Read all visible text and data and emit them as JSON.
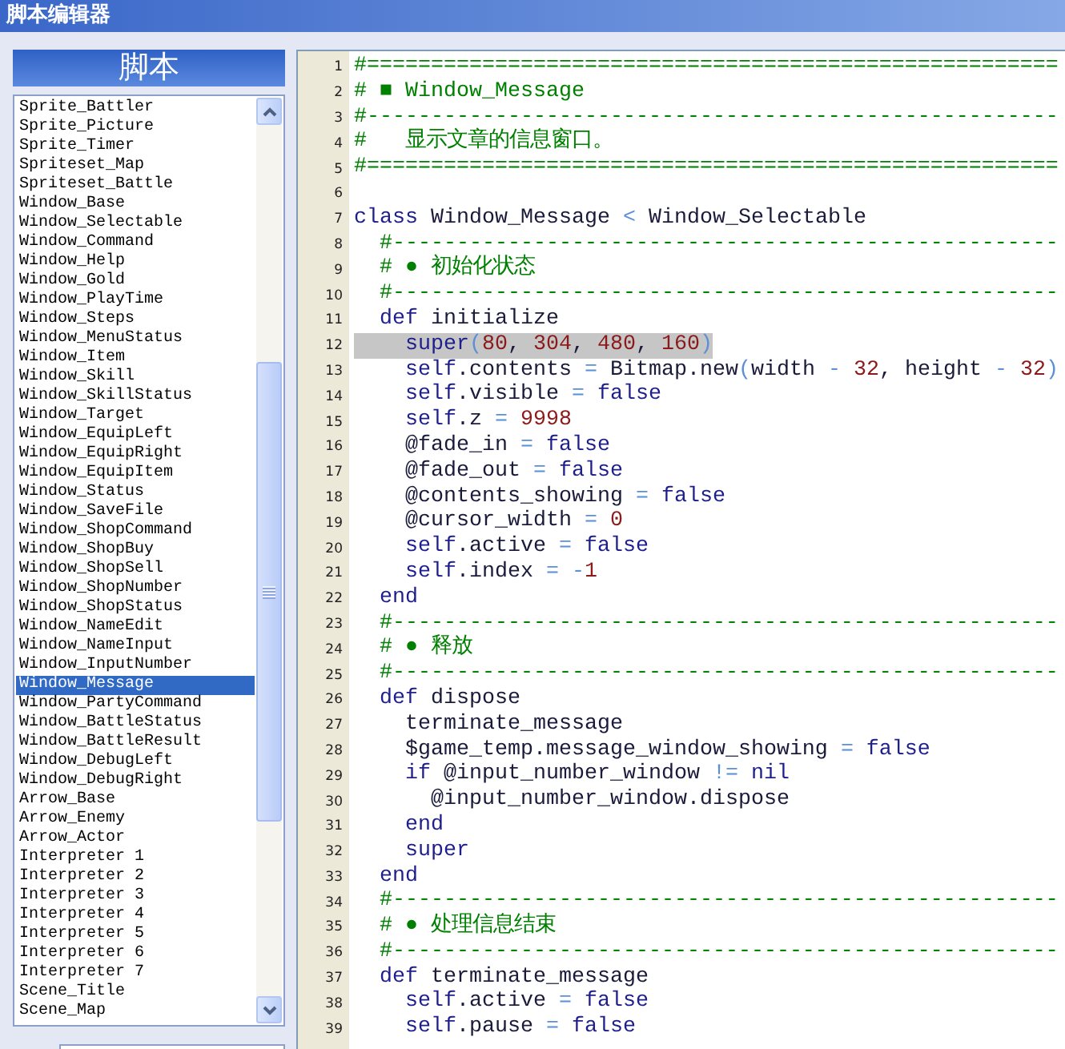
{
  "window": {
    "title": "脚本编辑器"
  },
  "sidebar": {
    "title": "脚本",
    "items": [
      {
        "label": "Sprite_Battler",
        "selected": false
      },
      {
        "label": "Sprite_Picture",
        "selected": false
      },
      {
        "label": "Sprite_Timer",
        "selected": false
      },
      {
        "label": "Spriteset_Map",
        "selected": false
      },
      {
        "label": "Spriteset_Battle",
        "selected": false
      },
      {
        "label": "Window_Base",
        "selected": false
      },
      {
        "label": "Window_Selectable",
        "selected": false
      },
      {
        "label": "Window_Command",
        "selected": false
      },
      {
        "label": "Window_Help",
        "selected": false
      },
      {
        "label": "Window_Gold",
        "selected": false
      },
      {
        "label": "Window_PlayTime",
        "selected": false
      },
      {
        "label": "Window_Steps",
        "selected": false
      },
      {
        "label": "Window_MenuStatus",
        "selected": false
      },
      {
        "label": "Window_Item",
        "selected": false
      },
      {
        "label": "Window_Skill",
        "selected": false
      },
      {
        "label": "Window_SkillStatus",
        "selected": false
      },
      {
        "label": "Window_Target",
        "selected": false
      },
      {
        "label": "Window_EquipLeft",
        "selected": false
      },
      {
        "label": "Window_EquipRight",
        "selected": false
      },
      {
        "label": "Window_EquipItem",
        "selected": false
      },
      {
        "label": "Window_Status",
        "selected": false
      },
      {
        "label": "Window_SaveFile",
        "selected": false
      },
      {
        "label": "Window_ShopCommand",
        "selected": false
      },
      {
        "label": "Window_ShopBuy",
        "selected": false
      },
      {
        "label": "Window_ShopSell",
        "selected": false
      },
      {
        "label": "Window_ShopNumber",
        "selected": false
      },
      {
        "label": "Window_ShopStatus",
        "selected": false
      },
      {
        "label": "Window_NameEdit",
        "selected": false
      },
      {
        "label": "Window_NameInput",
        "selected": false
      },
      {
        "label": "Window_InputNumber",
        "selected": false
      },
      {
        "label": "Window_Message",
        "selected": true
      },
      {
        "label": "Window_PartyCommand",
        "selected": false
      },
      {
        "label": "Window_BattleStatus",
        "selected": false
      },
      {
        "label": "Window_BattleResult",
        "selected": false
      },
      {
        "label": "Window_DebugLeft",
        "selected": false
      },
      {
        "label": "Window_DebugRight",
        "selected": false
      },
      {
        "label": "Arrow_Base",
        "selected": false
      },
      {
        "label": "Arrow_Enemy",
        "selected": false
      },
      {
        "label": "Arrow_Actor",
        "selected": false
      },
      {
        "label": "Interpreter 1",
        "selected": false
      },
      {
        "label": "Interpreter 2",
        "selected": false
      },
      {
        "label": "Interpreter 3",
        "selected": false
      },
      {
        "label": "Interpreter 4",
        "selected": false
      },
      {
        "label": "Interpreter 5",
        "selected": false
      },
      {
        "label": "Interpreter 6",
        "selected": false
      },
      {
        "label": "Interpreter 7",
        "selected": false
      },
      {
        "label": "Scene_Title",
        "selected": false
      },
      {
        "label": "Scene_Map",
        "selected": false
      }
    ]
  },
  "editor": {
    "lines": [
      {
        "number": "1",
        "selected": false,
        "tokens": [
          {
            "kind": "comment",
            "text": "#======================================================"
          }
        ]
      },
      {
        "number": "2",
        "selected": false,
        "tokens": [
          {
            "kind": "comment",
            "text": "# ■ Window_Message"
          }
        ]
      },
      {
        "number": "3",
        "selected": false,
        "tokens": [
          {
            "kind": "comment",
            "text": "#------------------------------------------------------"
          }
        ]
      },
      {
        "number": "4",
        "selected": false,
        "tokens": [
          {
            "kind": "comment",
            "text": "#   显示文章的信息窗口。"
          }
        ]
      },
      {
        "number": "5",
        "selected": false,
        "tokens": [
          {
            "kind": "comment",
            "text": "#======================================================"
          }
        ]
      },
      {
        "number": "6",
        "selected": false
      },
      {
        "number": "7",
        "selected": false,
        "tokens": [
          {
            "kind": "keyword",
            "text": "class"
          },
          {
            "kind": "name",
            "text": " Window_Message "
          },
          {
            "kind": "operator",
            "text": "<"
          },
          {
            "kind": "name",
            "text": " Window_Selectable"
          }
        ]
      },
      {
        "number": "8",
        "selected": false,
        "tokens": [
          {
            "kind": "comment",
            "text": "  #----------------------------------------------------"
          }
        ]
      },
      {
        "number": "9",
        "selected": false,
        "tokens": [
          {
            "kind": "comment",
            "text": "  # ● 初始化状态"
          }
        ]
      },
      {
        "number": "10",
        "selected": false,
        "tokens": [
          {
            "kind": "comment",
            "text": "  #----------------------------------------------------"
          }
        ]
      },
      {
        "number": "11",
        "selected": false,
        "tokens": [
          {
            "kind": "keyword",
            "text": "  def"
          },
          {
            "kind": "name",
            "text": " initialize"
          }
        ]
      },
      {
        "number": "12",
        "selected": true,
        "tokens": [
          {
            "kind": "keyword",
            "text": "    super"
          },
          {
            "kind": "operator",
            "text": "("
          },
          {
            "kind": "number",
            "text": "80"
          },
          {
            "kind": "name",
            "text": ", "
          },
          {
            "kind": "number",
            "text": "304"
          },
          {
            "kind": "name",
            "text": ", "
          },
          {
            "kind": "number",
            "text": "480"
          },
          {
            "kind": "name",
            "text": ", "
          },
          {
            "kind": "number",
            "text": "160"
          },
          {
            "kind": "operator",
            "text": ")"
          }
        ]
      },
      {
        "number": "13",
        "selected": false,
        "tokens": [
          {
            "kind": "keyword",
            "text": "    self"
          },
          {
            "kind": "name",
            "text": ".contents "
          },
          {
            "kind": "operator",
            "text": "="
          },
          {
            "kind": "name",
            "text": " Bitmap.new"
          },
          {
            "kind": "operator",
            "text": "("
          },
          {
            "kind": "name",
            "text": "width "
          },
          {
            "kind": "operator",
            "text": "-"
          },
          {
            "kind": "number",
            "text": " 32"
          },
          {
            "kind": "name",
            "text": ", height "
          },
          {
            "kind": "operator",
            "text": "-"
          },
          {
            "kind": "number",
            "text": " 32"
          },
          {
            "kind": "operator",
            "text": ")"
          }
        ]
      },
      {
        "number": "14",
        "selected": false,
        "tokens": [
          {
            "kind": "keyword",
            "text": "    self"
          },
          {
            "kind": "name",
            "text": ".visible "
          },
          {
            "kind": "operator",
            "text": "="
          },
          {
            "kind": "keyword",
            "text": " false"
          }
        ]
      },
      {
        "number": "15",
        "selected": false,
        "tokens": [
          {
            "kind": "keyword",
            "text": "    self"
          },
          {
            "kind": "name",
            "text": ".z "
          },
          {
            "kind": "operator",
            "text": "="
          },
          {
            "kind": "number",
            "text": " 9998"
          }
        ]
      },
      {
        "number": "16",
        "selected": false,
        "tokens": [
          {
            "kind": "name",
            "text": "    @fade_in "
          },
          {
            "kind": "operator",
            "text": "="
          },
          {
            "kind": "keyword",
            "text": " false"
          }
        ]
      },
      {
        "number": "17",
        "selected": false,
        "tokens": [
          {
            "kind": "name",
            "text": "    @fade_out "
          },
          {
            "kind": "operator",
            "text": "="
          },
          {
            "kind": "keyword",
            "text": " false"
          }
        ]
      },
      {
        "number": "18",
        "selected": false,
        "tokens": [
          {
            "kind": "name",
            "text": "    @contents_showing "
          },
          {
            "kind": "operator",
            "text": "="
          },
          {
            "kind": "keyword",
            "text": " false"
          }
        ]
      },
      {
        "number": "19",
        "selected": false,
        "tokens": [
          {
            "kind": "name",
            "text": "    @cursor_width "
          },
          {
            "kind": "operator",
            "text": "="
          },
          {
            "kind": "number",
            "text": " 0"
          }
        ]
      },
      {
        "number": "20",
        "selected": false,
        "tokens": [
          {
            "kind": "keyword",
            "text": "    self"
          },
          {
            "kind": "name",
            "text": ".active "
          },
          {
            "kind": "operator",
            "text": "="
          },
          {
            "kind": "keyword",
            "text": " false"
          }
        ]
      },
      {
        "number": "21",
        "selected": false,
        "tokens": [
          {
            "kind": "keyword",
            "text": "    self"
          },
          {
            "kind": "name",
            "text": ".index "
          },
          {
            "kind": "operator",
            "text": "= -"
          },
          {
            "kind": "number",
            "text": "1"
          }
        ]
      },
      {
        "number": "22",
        "selected": false,
        "tokens": [
          {
            "kind": "keyword",
            "text": "  end"
          }
        ]
      },
      {
        "number": "23",
        "selected": false,
        "tokens": [
          {
            "kind": "comment",
            "text": "  #----------------------------------------------------"
          }
        ]
      },
      {
        "number": "24",
        "selected": false,
        "tokens": [
          {
            "kind": "comment",
            "text": "  # ● 释放"
          }
        ]
      },
      {
        "number": "25",
        "selected": false,
        "tokens": [
          {
            "kind": "comment",
            "text": "  #----------------------------------------------------"
          }
        ]
      },
      {
        "number": "26",
        "selected": false,
        "tokens": [
          {
            "kind": "keyword",
            "text": "  def"
          },
          {
            "kind": "name",
            "text": " dispose"
          }
        ]
      },
      {
        "number": "27",
        "selected": false,
        "tokens": [
          {
            "kind": "name",
            "text": "    terminate_message"
          }
        ]
      },
      {
        "number": "28",
        "selected": false,
        "tokens": [
          {
            "kind": "name",
            "text": "    $game_temp.message_window_showing "
          },
          {
            "kind": "operator",
            "text": "="
          },
          {
            "kind": "keyword",
            "text": " false"
          }
        ]
      },
      {
        "number": "29",
        "selected": false,
        "tokens": [
          {
            "kind": "keyword",
            "text": "    if"
          },
          {
            "kind": "name",
            "text": " @input_number_window "
          },
          {
            "kind": "operator",
            "text": "!="
          },
          {
            "kind": "keyword",
            "text": " nil"
          }
        ]
      },
      {
        "number": "30",
        "selected": false,
        "tokens": [
          {
            "kind": "name",
            "text": "      @input_number_window.dispose"
          }
        ]
      },
      {
        "number": "31",
        "selected": false,
        "tokens": [
          {
            "kind": "keyword",
            "text": "    end"
          }
        ]
      },
      {
        "number": "32",
        "selected": false,
        "tokens": [
          {
            "kind": "keyword",
            "text": "    super"
          }
        ]
      },
      {
        "number": "33",
        "selected": false,
        "tokens": [
          {
            "kind": "keyword",
            "text": "  end"
          }
        ]
      },
      {
        "number": "34",
        "selected": false,
        "tokens": [
          {
            "kind": "comment",
            "text": "  #----------------------------------------------------"
          }
        ]
      },
      {
        "number": "35",
        "selected": false,
        "tokens": [
          {
            "kind": "comment",
            "text": "  # ● 处理信息结束"
          }
        ]
      },
      {
        "number": "36",
        "selected": false,
        "tokens": [
          {
            "kind": "comment",
            "text": "  #----------------------------------------------------"
          }
        ]
      },
      {
        "number": "37",
        "selected": false,
        "tokens": [
          {
            "kind": "keyword",
            "text": "  def"
          },
          {
            "kind": "name",
            "text": " terminate_message"
          }
        ]
      },
      {
        "number": "38",
        "selected": false,
        "tokens": [
          {
            "kind": "keyword",
            "text": "    self"
          },
          {
            "kind": "name",
            "text": ".active "
          },
          {
            "kind": "operator",
            "text": "="
          },
          {
            "kind": "keyword",
            "text": " false"
          }
        ]
      },
      {
        "number": "39",
        "selected": false,
        "tokens": [
          {
            "kind": "keyword",
            "text": "    self"
          },
          {
            "kind": "name",
            "text": ".pause "
          },
          {
            "kind": "operator",
            "text": "="
          },
          {
            "kind": "keyword",
            "text": " false"
          }
        ]
      }
    ]
  }
}
